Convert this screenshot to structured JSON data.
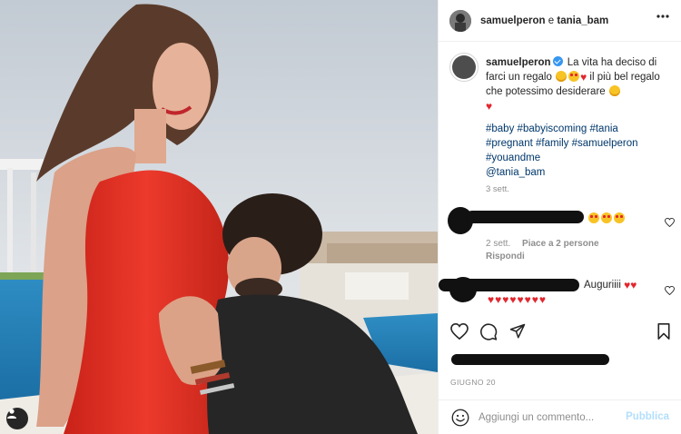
{
  "header": {
    "user1": "samuelperon",
    "conj": "e",
    "user2": "tania_bam"
  },
  "caption": {
    "username": "samuelperon",
    "text_part1": "La vita ha deciso di farci un regalo",
    "text_part2": "il più bel regalo che potessimo desiderare",
    "hashtags": [
      "#baby",
      "#babyiscoming",
      "#tania",
      "#pregnant",
      "#family",
      "#samuelperon",
      "#youandme"
    ],
    "mention": "@tania_bam",
    "time": "3 sett."
  },
  "comments": [
    {
      "time": "2 sett.",
      "likes": "Piace a 2 persone",
      "reply": "Rispondi"
    },
    {
      "text": "Auguriiii"
    }
  ],
  "date_label": "GIUGNO 20",
  "add_comment": {
    "placeholder": "Aggiungi un commento...",
    "publish": "Pubblica"
  },
  "icons": [
    "more-icon",
    "heart-icon",
    "comment-icon",
    "share-icon",
    "bookmark-icon",
    "smiley-icon",
    "user-tag-icon",
    "verified-badge"
  ],
  "colors": {
    "link": "#00376b",
    "verified": "#3897f0",
    "muted": "#8e8e8e",
    "publish": "#b2dffc",
    "dress": "#e8322a"
  }
}
